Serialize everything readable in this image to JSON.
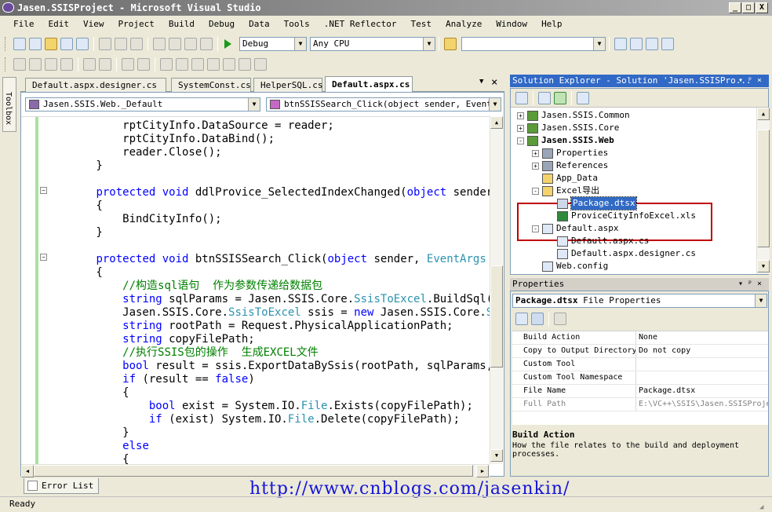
{
  "window": {
    "title": "Jasen.SSISProject - Microsoft Visual Studio",
    "minimize": "_",
    "maximize": "□",
    "close": "X"
  },
  "menu": [
    "File",
    "Edit",
    "View",
    "Project",
    "Build",
    "Debug",
    "Data",
    "Tools",
    ".NET Reflector",
    "Test",
    "Analyze",
    "Window",
    "Help"
  ],
  "toolbar": {
    "config": "Debug",
    "platform": "Any CPU",
    "search": ""
  },
  "toolbox": {
    "label": "Toolbox"
  },
  "tabs": [
    {
      "label": "Default.aspx.designer.cs"
    },
    {
      "label": "SystemConst.cs"
    },
    {
      "label": "HelperSQL.cs"
    },
    {
      "label": "Default.aspx.cs"
    }
  ],
  "tabs_close": "×",
  "editor": {
    "class_combo": "Jasen.SSIS.Web._Default",
    "method_combo": "btnSSISSearch_Click(object sender, EventArgs e)",
    "lines": [
      [
        {
          "t": "            rptCityInfo.DataSource = reader;"
        }
      ],
      [
        {
          "t": "            rptCityInfo.DataBind();"
        }
      ],
      [
        {
          "t": "            reader.Close();"
        }
      ],
      [
        {
          "t": "        }"
        }
      ],
      [
        {
          "t": ""
        }
      ],
      [
        {
          "t": "        "
        },
        {
          "t": "protected",
          "c": "kw"
        },
        {
          "t": " "
        },
        {
          "t": "void",
          "c": "kw"
        },
        {
          "t": " ddlProvice_SelectedIndexChanged("
        },
        {
          "t": "object",
          "c": "kw"
        },
        {
          "t": " sender,"
        }
      ],
      [
        {
          "t": "        {"
        }
      ],
      [
        {
          "t": "            BindCityInfo();"
        }
      ],
      [
        {
          "t": "        }"
        }
      ],
      [
        {
          "t": ""
        }
      ],
      [
        {
          "t": "        "
        },
        {
          "t": "protected",
          "c": "kw"
        },
        {
          "t": " "
        },
        {
          "t": "void",
          "c": "kw"
        },
        {
          "t": " btnSSISSearch_Click("
        },
        {
          "t": "object",
          "c": "kw"
        },
        {
          "t": " sender, "
        },
        {
          "t": "EventArgs",
          "c": "ty"
        },
        {
          "t": " e)"
        }
      ],
      [
        {
          "t": "        {"
        }
      ],
      [
        {
          "t": "            "
        },
        {
          "t": "//构造sql语句  作为参数传递给数据包",
          "c": "cm"
        }
      ],
      [
        {
          "t": "            "
        },
        {
          "t": "string",
          "c": "kw"
        },
        {
          "t": " sqlParams = Jasen.SSIS.Core."
        },
        {
          "t": "SsisToExcel",
          "c": "ty"
        },
        {
          "t": ".BuildSql("
        },
        {
          "t": "\"d",
          "c": "st"
        }
      ],
      [
        {
          "t": "            Jasen.SSIS.Core."
        },
        {
          "t": "SsisToExcel",
          "c": "ty"
        },
        {
          "t": " ssis = "
        },
        {
          "t": "new",
          "c": "kw"
        },
        {
          "t": " Jasen.SSIS.Core."
        },
        {
          "t": "Ssi",
          "c": "ty"
        }
      ],
      [
        {
          "t": "            "
        },
        {
          "t": "string",
          "c": "kw"
        },
        {
          "t": " rootPath = Request.PhysicalApplicationPath;"
        }
      ],
      [
        {
          "t": "            "
        },
        {
          "t": "string",
          "c": "kw"
        },
        {
          "t": " copyFilePath;"
        }
      ],
      [
        {
          "t": "            "
        },
        {
          "t": "//执行SSIS包的操作  生成EXCEL文件",
          "c": "cm"
        }
      ],
      [
        {
          "t": "            "
        },
        {
          "t": "bool",
          "c": "kw"
        },
        {
          "t": " result = ssis.ExportDataBySsis(rootPath, sqlParams, o"
        }
      ],
      [
        {
          "t": "            "
        },
        {
          "t": "if",
          "c": "kw"
        },
        {
          "t": " (result == "
        },
        {
          "t": "false",
          "c": "kw"
        },
        {
          "t": ")"
        }
      ],
      [
        {
          "t": "            {"
        }
      ],
      [
        {
          "t": "                "
        },
        {
          "t": "bool",
          "c": "kw"
        },
        {
          "t": " exist = System.IO."
        },
        {
          "t": "File",
          "c": "ty"
        },
        {
          "t": ".Exists(copyFilePath);"
        }
      ],
      [
        {
          "t": "                "
        },
        {
          "t": "if",
          "c": "kw"
        },
        {
          "t": " (exist) System.IO."
        },
        {
          "t": "File",
          "c": "ty"
        },
        {
          "t": ".Delete(copyFilePath);"
        }
      ],
      [
        {
          "t": "            }"
        }
      ],
      [
        {
          "t": "            "
        },
        {
          "t": "else",
          "c": "kw"
        }
      ],
      [
        {
          "t": "            {"
        }
      ]
    ]
  },
  "solution": {
    "title": "Solution Explorer - Solution 'Jasen.SSISPro...",
    "pin": "▾ ᵖ ×",
    "nodes": [
      {
        "label": "Jasen.SSIS.Common",
        "exp": "+",
        "indent": 0,
        "icon": "csproj-icon",
        "bold": false
      },
      {
        "label": "Jasen.SSIS.Core",
        "exp": "+",
        "indent": 0,
        "icon": "csproj-icon",
        "bold": false
      },
      {
        "label": "Jasen.SSIS.Web",
        "exp": "-",
        "indent": 0,
        "icon": "webproj-icon",
        "bold": true
      },
      {
        "label": "Properties",
        "exp": "+",
        "indent": 1,
        "icon": "properties-icon",
        "bold": false
      },
      {
        "label": "References",
        "exp": "+",
        "indent": 1,
        "icon": "references-icon",
        "bold": false
      },
      {
        "label": "App_Data",
        "exp": "",
        "indent": 1,
        "icon": "folder-icon",
        "bold": false
      },
      {
        "label": "Excel导出",
        "exp": "-",
        "indent": 1,
        "icon": "folder-open-icon",
        "bold": false
      },
      {
        "label": "Package.dtsx",
        "exp": "",
        "indent": 2,
        "icon": "dtsx-icon",
        "bold": false,
        "selected": true
      },
      {
        "label": "ProviceCityInfoExcel.xls",
        "exp": "",
        "indent": 2,
        "icon": "excel-icon",
        "bold": false
      },
      {
        "label": "Default.aspx",
        "exp": "-",
        "indent": 1,
        "icon": "aspx-icon",
        "bold": false
      },
      {
        "label": "Default.aspx.cs",
        "exp": "",
        "indent": 2,
        "icon": "cs-file-icon",
        "bold": false
      },
      {
        "label": "Default.aspx.designer.cs",
        "exp": "",
        "indent": 2,
        "icon": "cs-file-icon",
        "bold": false
      },
      {
        "label": "Web.config",
        "exp": "",
        "indent": 1,
        "icon": "config-icon",
        "bold": false
      }
    ]
  },
  "properties": {
    "title": "Properties",
    "pin": "▾ ᵖ ×",
    "object": "Package.dtsx",
    "object_type": "File Properties",
    "rows": [
      {
        "name": "Build Action",
        "value": "None",
        "gray": false
      },
      {
        "name": "Copy to Output Directory",
        "value": "Do not copy",
        "gray": false
      },
      {
        "name": "Custom Tool",
        "value": "",
        "gray": false
      },
      {
        "name": "Custom Tool Namespace",
        "value": "",
        "gray": false
      },
      {
        "name": "File Name",
        "value": "Package.dtsx",
        "gray": false
      },
      {
        "name": "Full Path",
        "value": "E:\\VC++\\SSIS\\Jasen.SSISProje",
        "gray": true
      }
    ],
    "desc_title": "Build Action",
    "desc_text": "How the file relates to the build and deployment processes."
  },
  "bottom": {
    "error_list": "Error List"
  },
  "status": {
    "text": "Ready"
  },
  "watermark": "http://www.cnblogs.com/jasenkin/",
  "colors": {
    "keyword": "#0000ff",
    "type": "#2b91af",
    "comment": "#008000",
    "selection": "#316ac5",
    "highlight_box": "#c00000",
    "watermark": "#1414d8"
  }
}
